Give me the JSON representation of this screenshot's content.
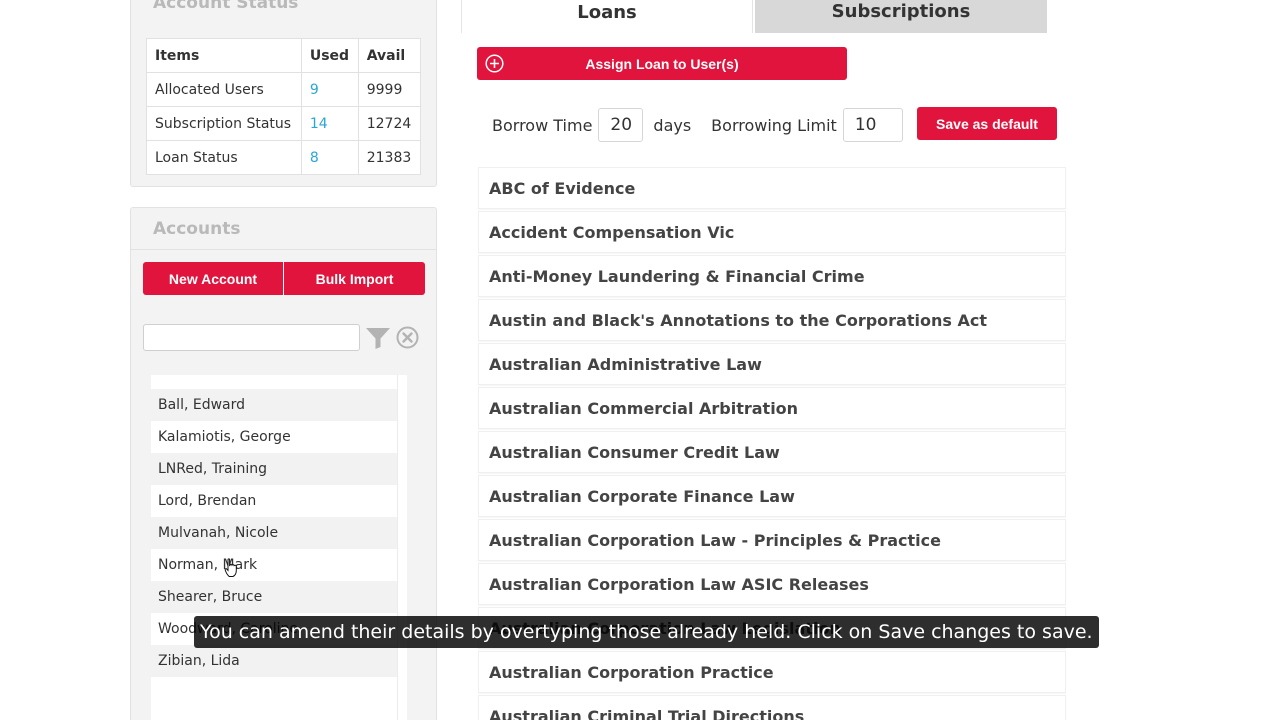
{
  "account_status": {
    "title": "Account Status",
    "columns": [
      "Items",
      "Used",
      "Avail"
    ],
    "rows": [
      {
        "item": "Allocated Users",
        "used": "9",
        "avail": "9999"
      },
      {
        "item": "Subscription Status",
        "used": "14",
        "avail": "12724"
      },
      {
        "item": "Loan Status",
        "used": "8",
        "avail": "21383"
      }
    ]
  },
  "accounts": {
    "title": "Accounts",
    "new_account_label": "New Account",
    "bulk_import_label": "Bulk Import",
    "search_value": "",
    "items": [
      "Ball, Edward",
      "Kalamiotis, George",
      "LNRed, Training",
      "Lord, Brendan",
      "Mulvanah, Nicole",
      "Norman, Mark",
      "Shearer, Bruce",
      "Woodward, Caroline",
      "Zibian, Lida"
    ]
  },
  "tabs": {
    "loans": "Loans",
    "subscriptions": "Subscriptions"
  },
  "loans": {
    "assign_label": "Assign Loan to User(s)",
    "borrow_time_label": "Borrow Time",
    "borrow_time_value": "20",
    "days_label": "days",
    "borrowing_limit_label": "Borrowing Limit",
    "borrowing_limit_value": "10",
    "save_default_label": "Save as default",
    "titles": [
      "ABC of Evidence",
      "Accident Compensation Vic",
      "Anti-Money Laundering & Financial Crime",
      "Austin and Black's Annotations to the Corporations Act",
      "Australian Administrative Law",
      "Australian Commercial Arbitration",
      "Australian Consumer Credit Law",
      "Australian Corporate Finance Law",
      "Australian Corporation Law - Principles & Practice",
      "Australian Corporation Law ASIC Releases",
      "Australian Corporation Law Legislation",
      "Australian Corporation Practice",
      "Australian Criminal Trial Directions"
    ]
  },
  "subtitle": "You can amend their details by overtyping those already held. Click on Save changes to save.",
  "colors": {
    "accent": "#e0143c",
    "used_value": "#2aa6d6",
    "panel_bg": "#f3f3f3",
    "inactive_tab": "#d8d8d8"
  },
  "icons": {
    "assign": "plus-circle-icon",
    "filter": "filter-icon",
    "clear": "clear-circle-icon",
    "cursor": "hand-pointer-icon"
  }
}
